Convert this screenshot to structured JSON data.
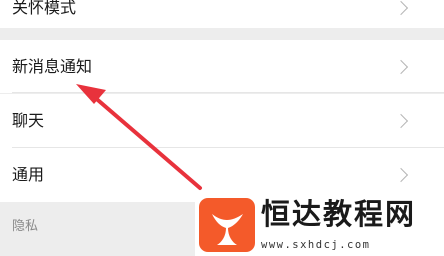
{
  "settings": {
    "items": [
      {
        "label": "关怀模式"
      },
      {
        "label": "新消息通知"
      },
      {
        "label": "聊天"
      },
      {
        "label": "通用"
      }
    ],
    "section_label": "隐私"
  },
  "annotation": {
    "arrow_color": "#e8323c",
    "arrow_target": "新消息通知"
  },
  "watermark": {
    "name": "恒达教程网",
    "url": "www.sxhdcj.com",
    "brand_color": "#f45a2a",
    "logo_icon": "whale-tail-logo-icon"
  }
}
